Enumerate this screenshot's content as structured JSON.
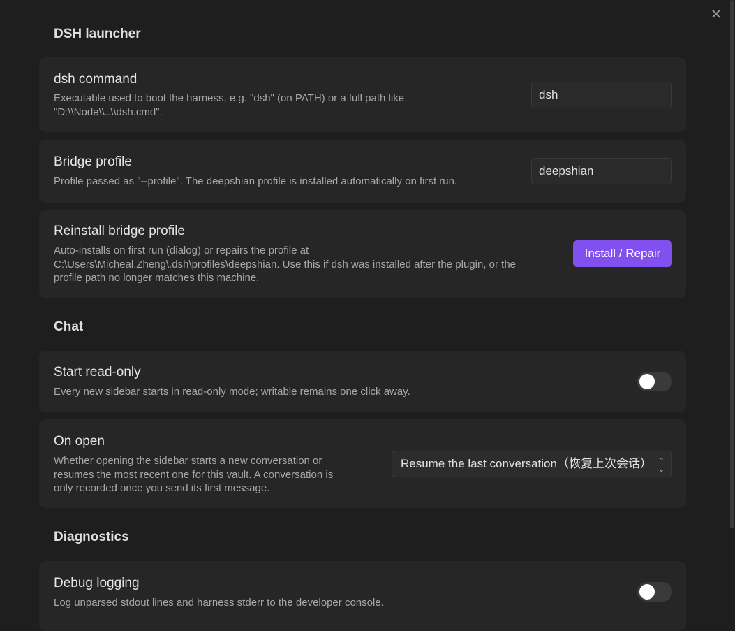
{
  "sections": {
    "launcher": "DSH launcher",
    "chat": "Chat",
    "diagnostics": "Diagnostics"
  },
  "dsh_command": {
    "title": "dsh command",
    "desc_line1": "Executable used to boot the harness, e.g. \"dsh\" (on PATH) or a full path like",
    "desc_line2": "\"D:\\\\Node\\\\..\\\\dsh.cmd\".",
    "value": "dsh"
  },
  "bridge_profile": {
    "title": "Bridge profile",
    "desc": "Profile passed as \"--profile\". The deepshian profile is installed automatically on first run.",
    "value": "deepshian"
  },
  "reinstall": {
    "title": "Reinstall bridge profile",
    "desc_line1": "Auto-installs on first run (dialog) or repairs the profile at",
    "desc_line2": "C:\\Users\\Micheal.Zheng\\.dsh\\profiles\\deepshian. Use this if dsh was installed after the plugin, or the",
    "desc_line3": "profile path no longer matches this machine.",
    "button_label": "Install / Repair"
  },
  "start_read_only": {
    "title": "Start read-only",
    "desc": "Every new sidebar starts in read-only mode; writable remains one click away.",
    "enabled": false
  },
  "on_open": {
    "title": "On open",
    "desc_line1": "Whether opening the sidebar starts a new conversation or",
    "desc_line2": "resumes the most recent one for this vault. A conversation is",
    "desc_line3": "only recorded once you send its first message.",
    "selected": "Resume the last conversation（恢复上次会话）"
  },
  "debug_logging": {
    "title": "Debug logging",
    "desc": "Log unparsed stdout lines and harness stderr to the developer console.",
    "enabled": false
  },
  "icons": {
    "close": "close-icon",
    "select_chevron": "chevron-up-down-icon"
  },
  "colors": {
    "accent": "#8250ee",
    "background": "#1e1e1e",
    "card": "#262626"
  }
}
